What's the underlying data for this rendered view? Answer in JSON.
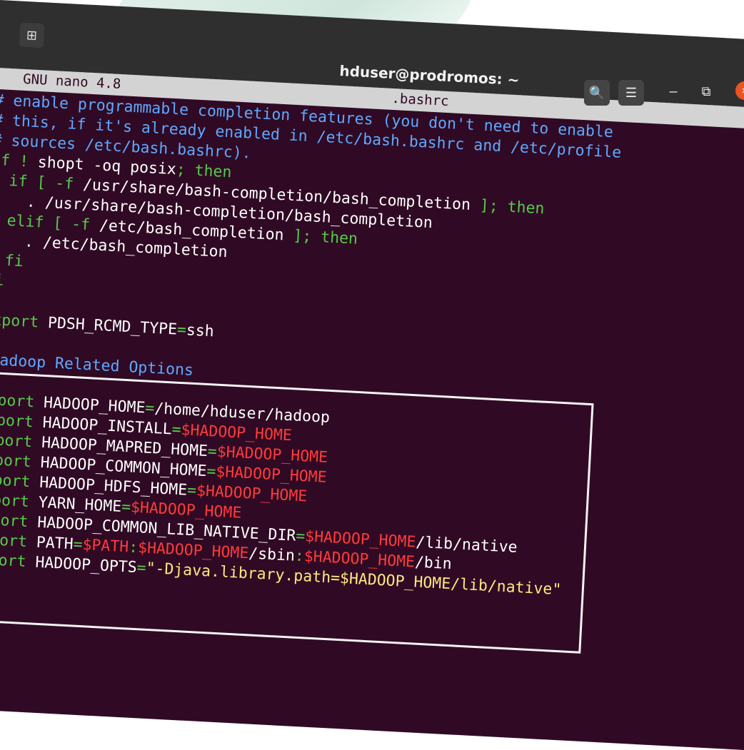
{
  "window": {
    "title": "hduser@prodromos: ~",
    "new_tab_icon": "⊞",
    "search_icon": "🔍",
    "menu_icon": "☰",
    "minimize_icon": "–",
    "restore_icon": "⧉",
    "close_icon": "✕"
  },
  "nano": {
    "version": "GNU nano 4.8",
    "filename": ".bashrc"
  },
  "code_lines": [
    [
      {
        "t": "# enable programmable completion features (you don't need to enable",
        "c": "c"
      }
    ],
    [
      {
        "t": "# this, if it's already enabled in /etc/bash.bashrc and /etc/profile",
        "c": "c"
      }
    ],
    [
      {
        "t": "# sources /etc/bash.bashrc).",
        "c": "c"
      }
    ],
    [
      {
        "t": "if ! ",
        "c": "k"
      },
      {
        "t": "shopt -oq posix",
        "c": "w"
      },
      {
        "t": "; then",
        "c": "k"
      }
    ],
    [
      {
        "t": "  if [ -f ",
        "c": "k"
      },
      {
        "t": "/usr/share/bash-completion/bash_completion",
        "c": "w"
      },
      {
        "t": " ]; then",
        "c": "k"
      }
    ],
    [
      {
        "t": "    . /usr/share/bash-completion/bash_completion",
        "c": "w"
      }
    ],
    [
      {
        "t": "  elif [ -f ",
        "c": "k"
      },
      {
        "t": "/etc/bash_completion",
        "c": "w"
      },
      {
        "t": " ]; then",
        "c": "k"
      }
    ],
    [
      {
        "t": "    . /etc/bash_completion",
        "c": "w"
      }
    ],
    [
      {
        "t": "  fi",
        "c": "k"
      }
    ],
    [
      {
        "t": "fi",
        "c": "k"
      }
    ],
    [
      {
        "t": "",
        "c": "w"
      }
    ],
    [
      {
        "t": "export ",
        "c": "k"
      },
      {
        "t": "PDSH_RCMD_TYPE",
        "c": "w"
      },
      {
        "t": "=",
        "c": "k"
      },
      {
        "t": "ssh",
        "c": "w"
      }
    ],
    [
      {
        "t": "",
        "c": "w"
      }
    ],
    [
      {
        "t": "#Hadoop Related Options",
        "c": "c"
      }
    ],
    [
      {
        "t": "",
        "c": "w"
      }
    ],
    [
      {
        "t": "export ",
        "c": "k"
      },
      {
        "t": "HADOOP_HOME",
        "c": "w"
      },
      {
        "t": "=",
        "c": "k"
      },
      {
        "t": "/home/hduser/hadoop",
        "c": "w"
      }
    ],
    [
      {
        "t": "export ",
        "c": "k"
      },
      {
        "t": "HADOOP_INSTALL",
        "c": "w"
      },
      {
        "t": "=",
        "c": "k"
      },
      {
        "t": "$HADOOP_HOME",
        "c": "v"
      }
    ],
    [
      {
        "t": "export ",
        "c": "k"
      },
      {
        "t": "HADOOP_MAPRED_HOME",
        "c": "w"
      },
      {
        "t": "=",
        "c": "k"
      },
      {
        "t": "$HADOOP_HOME",
        "c": "v"
      }
    ],
    [
      {
        "t": "export ",
        "c": "k"
      },
      {
        "t": "HADOOP_COMMON_HOME",
        "c": "w"
      },
      {
        "t": "=",
        "c": "k"
      },
      {
        "t": "$HADOOP_HOME",
        "c": "v"
      }
    ],
    [
      {
        "t": "export ",
        "c": "k"
      },
      {
        "t": "HADOOP_HDFS_HOME",
        "c": "w"
      },
      {
        "t": "=",
        "c": "k"
      },
      {
        "t": "$HADOOP_HOME",
        "c": "v"
      }
    ],
    [
      {
        "t": "export ",
        "c": "k"
      },
      {
        "t": "YARN_HOME",
        "c": "w"
      },
      {
        "t": "=",
        "c": "k"
      },
      {
        "t": "$HADOOP_HOME",
        "c": "v"
      }
    ],
    [
      {
        "t": "export ",
        "c": "k"
      },
      {
        "t": "HADOOP_COMMON_LIB_NATIVE_DIR",
        "c": "w"
      },
      {
        "t": "=",
        "c": "k"
      },
      {
        "t": "$HADOOP_HOME",
        "c": "v"
      },
      {
        "t": "/lib/native",
        "c": "w"
      }
    ],
    [
      {
        "t": "export ",
        "c": "k"
      },
      {
        "t": "PATH",
        "c": "w"
      },
      {
        "t": "=",
        "c": "k"
      },
      {
        "t": "$PATH",
        "c": "v"
      },
      {
        "t": ":",
        "c": "k"
      },
      {
        "t": "$HADOOP_HOME",
        "c": "v"
      },
      {
        "t": "/sbin",
        "c": "w"
      },
      {
        "t": ":",
        "c": "k"
      },
      {
        "t": "$HADOOP_HOME",
        "c": "v"
      },
      {
        "t": "/bin",
        "c": "w"
      }
    ],
    [
      {
        "t": "export ",
        "c": "k"
      },
      {
        "t": "HADOOP_OPTS",
        "c": "w"
      },
      {
        "t": "=",
        "c": "k"
      },
      {
        "t": "\"-Djava.library.path=$HADOOP_HOME/lib/native\"",
        "c": "s"
      }
    ]
  ],
  "colors": {
    "terminal_bg": "#300a24",
    "titlebar_bg": "#2f2f2f",
    "comment": "#5fa8ff",
    "keyword": "#55c94a",
    "variable": "#ff3b3b",
    "string": "#ffe680",
    "close_button": "#e95420"
  }
}
